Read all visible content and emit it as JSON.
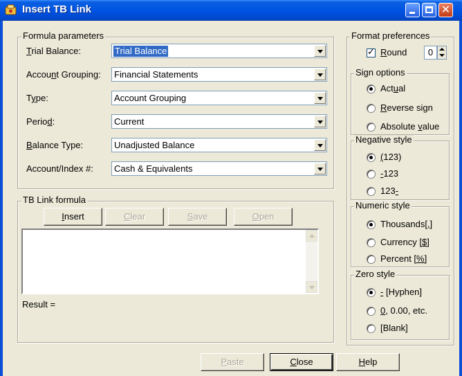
{
  "window": {
    "title": "Insert TB Link"
  },
  "formula_parameters": {
    "legend": "Formula parameters",
    "rows": [
      {
        "label": "Trial Balance:",
        "value": "Trial Balance"
      },
      {
        "label": "Account Grouping:",
        "value": "Financial Statements"
      },
      {
        "label": "Type:",
        "value": "Account Grouping"
      },
      {
        "label": "Period:",
        "value": "Current"
      },
      {
        "label": "Balance Type:",
        "value": "Unadjusted Balance"
      },
      {
        "label": "Account/Index #:",
        "value": "Cash & Equivalents"
      }
    ]
  },
  "tb_link_formula": {
    "legend": "TB Link formula",
    "buttons": {
      "insert": "Insert",
      "clear": "Clear",
      "save": "Save",
      "open": "Open"
    },
    "formula_text": "",
    "result_label": "Result ="
  },
  "format_preferences": {
    "legend": "Format preferences",
    "round_label": "Round",
    "round_checked": true,
    "round_value": "0"
  },
  "sign_options": {
    "legend": "Sign options",
    "options": [
      "Actual",
      "Reverse sign",
      "Absolute value"
    ],
    "selected": 0
  },
  "negative_style": {
    "legend": "Negative style",
    "options": [
      "(123)",
      "-123",
      "123-"
    ],
    "selected": 0
  },
  "numeric_style": {
    "legend": "Numeric style",
    "options": [
      "Thousands[,]",
      "Currency [$]",
      "Percent [%]"
    ],
    "selected": 0
  },
  "zero_style": {
    "legend": "Zero style",
    "options": [
      "- [Hyphen]",
      "0, 0.00, etc.",
      "[Blank]"
    ],
    "selected": 0
  },
  "footer": {
    "paste": "Paste",
    "close": "Close",
    "help": "Help"
  },
  "colors": {
    "titlebar": "#0054e3",
    "face": "#ece9d8",
    "selection": "#316ac5"
  }
}
